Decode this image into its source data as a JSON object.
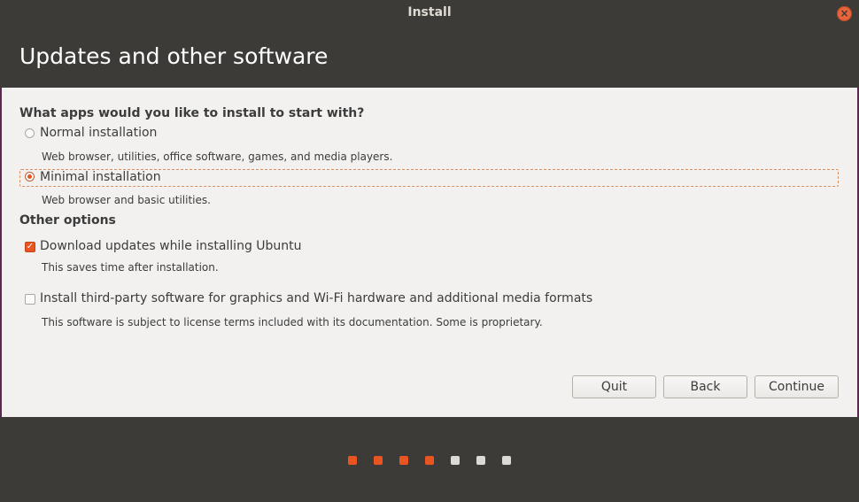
{
  "window": {
    "title": "Install",
    "close_icon": "×"
  },
  "header": {
    "title": "Updates and other software"
  },
  "install_type": {
    "heading": "What apps would you like to install to start with?",
    "options": [
      {
        "label": "Normal installation",
        "description": "Web browser, utilities, office software, games, and media players.",
        "selected": false
      },
      {
        "label": "Minimal installation",
        "description": "Web browser and basic utilities.",
        "selected": true
      }
    ]
  },
  "other_options": {
    "heading": "Other options",
    "items": [
      {
        "label": "Download updates while installing Ubuntu",
        "description": "This saves time after installation.",
        "checked": true
      },
      {
        "label": "Install third-party software for graphics and Wi-Fi hardware and additional media formats",
        "description": "This software is subject to license terms included with its documentation. Some is proprietary.",
        "checked": false
      }
    ]
  },
  "buttons": {
    "quit": "Quit",
    "back": "Back",
    "continue": "Continue"
  },
  "progress": {
    "total_steps": 7,
    "completed_steps": 4,
    "active_color": "#e95420",
    "inactive_color": "#dcdad5"
  },
  "colors": {
    "accent": "#e95420",
    "dark": "#3c3b37",
    "panel": "#f2f1f0"
  }
}
